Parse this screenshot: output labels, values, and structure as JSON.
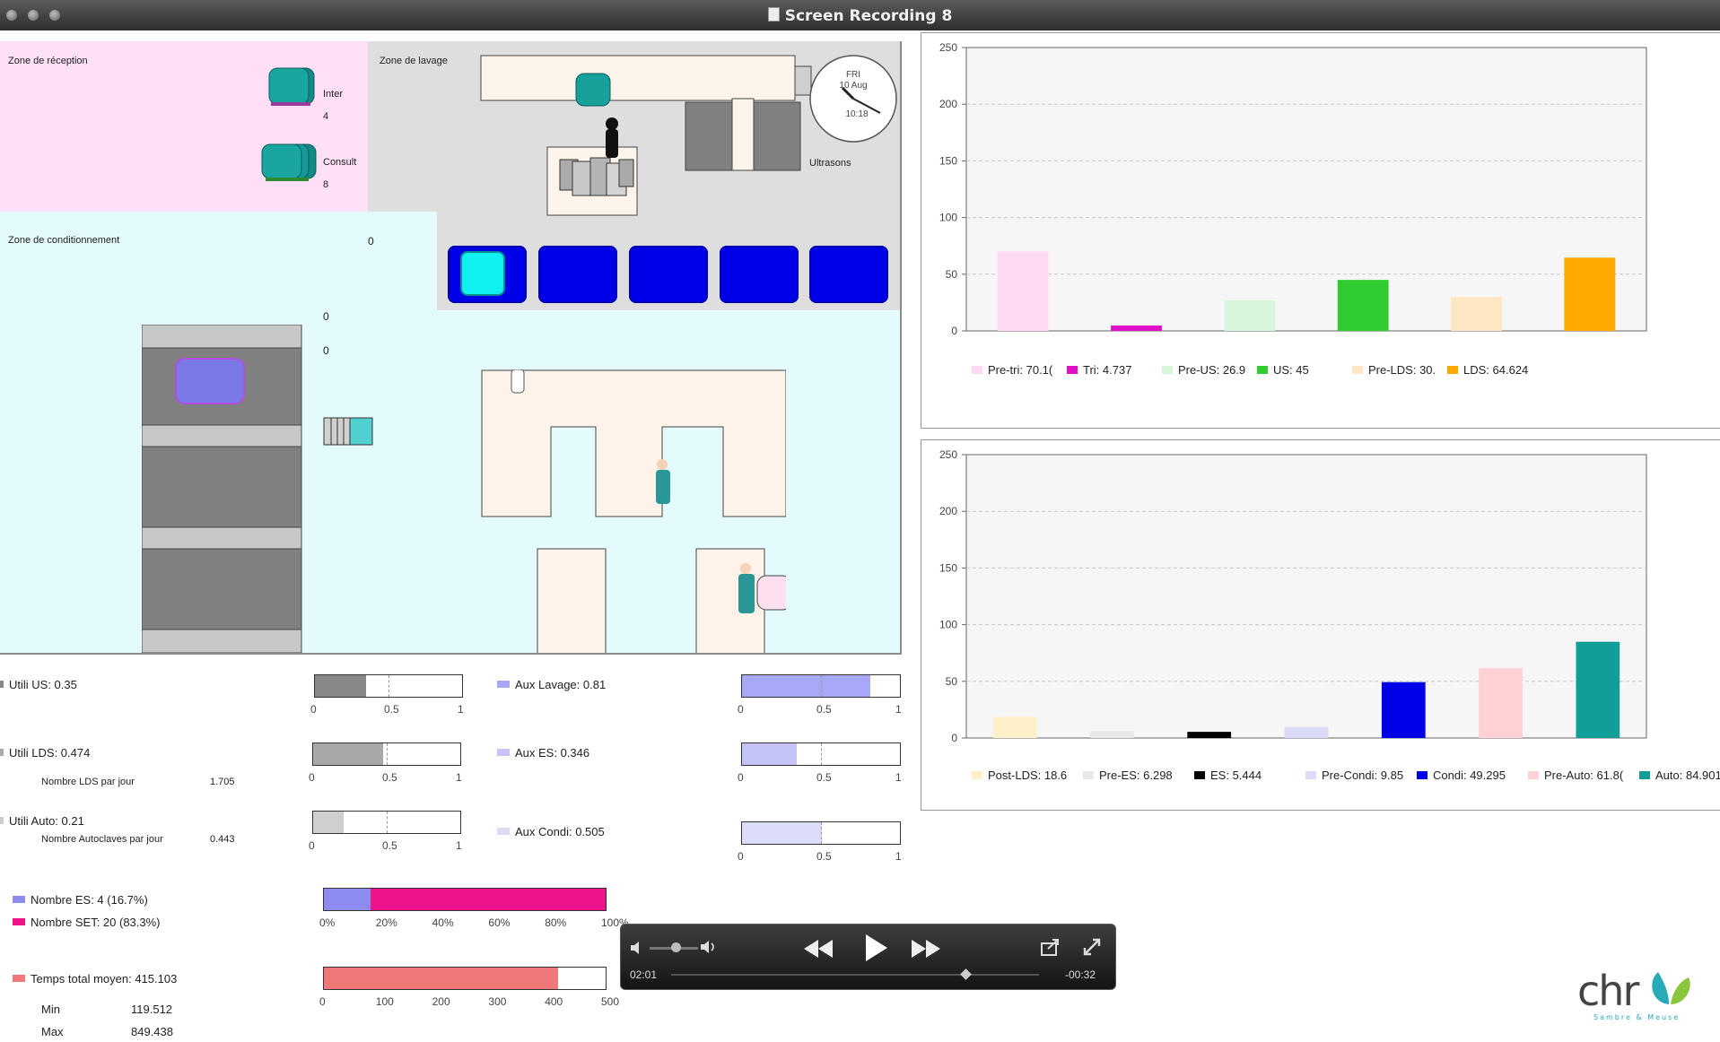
{
  "window": {
    "title": "Screen Recording 8"
  },
  "simulation": {
    "zones": {
      "reception": "Zone de réception",
      "lavage": "Zone de lavage",
      "conditionnement": "Zone de conditionnement"
    },
    "reception": {
      "inter_label": "Inter",
      "inter_count": "4",
      "consult_label": "Consult",
      "consult_count": "8"
    },
    "ultrasons_label": "Ultrasons",
    "clock": {
      "day": "FRI",
      "date": "10 Aug",
      "time": "10:18"
    },
    "counters": {
      "conditionnement": "0",
      "autoclave_top": "0",
      "autoclave_second": "0"
    }
  },
  "chart_top": {
    "legend": [
      {
        "label": "Pre-tri: 70.1(",
        "color": "#ffd8f4"
      },
      {
        "label": "Tri: 4.737",
        "color": "#e010c8"
      },
      {
        "label": "Pre-US: 26.9",
        "color": "#d6f7dc"
      },
      {
        "label": "US: 45",
        "color": "#30cc30"
      },
      {
        "label": "Pre-LDS: 30.",
        "color": "#ffe7c4"
      },
      {
        "label": "LDS: 64.624",
        "color": "#ffa800"
      }
    ]
  },
  "chart_bottom": {
    "legend": [
      {
        "label": "Post-LDS: 18.6",
        "color": "#fff0c8"
      },
      {
        "label": "Pre-ES: 6.298",
        "color": "#e8e8e8"
      },
      {
        "label": "ES: 5.444",
        "color": "#000000"
      },
      {
        "label": "Pre-Condi: 9.85",
        "color": "#dcdcf8"
      },
      {
        "label": "Condi: 49.295",
        "color": "#0000e8"
      },
      {
        "label": "Pre-Auto: 61.8(",
        "color": "#ffd0d4"
      },
      {
        "label": "Auto: 84.901",
        "color": "#129e98"
      }
    ]
  },
  "chart_data": [
    {
      "type": "bar",
      "categories": [
        "Pre-tri",
        "Tri",
        "Pre-US",
        "US",
        "Pre-LDS",
        "LDS"
      ],
      "values": [
        70.1,
        4.737,
        26.9,
        45,
        30,
        64.624
      ],
      "ylim": [
        0,
        250
      ],
      "yticks": [
        "0",
        "50",
        "100",
        "150",
        "200",
        "250"
      ],
      "grid": true,
      "legend_position": "bottom"
    },
    {
      "type": "bar",
      "categories": [
        "Post-LDS",
        "Pre-ES",
        "ES",
        "Pre-Condi",
        "Condi",
        "Pre-Auto",
        "Auto"
      ],
      "values": [
        18.6,
        6.298,
        5.444,
        9.85,
        49.295,
        61.8,
        84.901
      ],
      "ylim": [
        0,
        250
      ],
      "yticks": [
        "0",
        "50",
        "100",
        "150",
        "200",
        "250"
      ],
      "grid": true,
      "legend_position": "bottom"
    }
  ],
  "stats": {
    "utili_us": {
      "label": "Utili US: 0.35",
      "value": 0.35,
      "color": "#888888"
    },
    "utili_lds": {
      "label": "Utili LDS: 0.474",
      "value": 0.474,
      "color": "#a8a8a8"
    },
    "lds_per_day": {
      "label": "Nombre LDS par jour",
      "value": "1.705"
    },
    "utili_auto": {
      "label": "Utili Auto: 0.21",
      "value": 0.21,
      "color": "#cfcfcf"
    },
    "auto_per_day": {
      "label": "Nombre Autoclaves par jour",
      "value": "0.443"
    },
    "aux_lavage": {
      "label": "Aux Lavage: 0.81",
      "value": 0.81,
      "color": "#a8a8f8"
    },
    "aux_es": {
      "label": "Aux ES: 0.346",
      "value": 0.346,
      "color": "#c4c4f8"
    },
    "aux_condi": {
      "label": "Aux Condi: 0.505",
      "value": 0.505,
      "color": "#dcdcf6"
    },
    "scale_ticks": [
      "0",
      "0.5",
      "1"
    ],
    "nombre_es": {
      "label": "Nombre ES: 4 (16.7%)",
      "value": 0.167,
      "color": "#8c8cf0"
    },
    "nombre_set": {
      "label": "Nombre SET: 20 (83.3%)",
      "value": 0.833,
      "color": "#f0148c"
    },
    "pct_ticks": [
      "0%",
      "20%",
      "40%",
      "60%",
      "80%",
      "100%"
    ],
    "temps": {
      "label": "Temps total moyen: 415.103",
      "value": 415.103,
      "max": 500,
      "color": "#f07878"
    },
    "temps_ticks": [
      "0",
      "100",
      "200",
      "300",
      "400",
      "500"
    ],
    "min_label": "Min",
    "min_value": "119.512",
    "max_label": "Max",
    "max_value": "849.438"
  },
  "player": {
    "elapsed": "02:01",
    "remaining": "-00:32",
    "progress": 0.79,
    "volume": 0.45
  },
  "logo": {
    "text": "chr",
    "subtitle": "Sambre & Meuse"
  }
}
